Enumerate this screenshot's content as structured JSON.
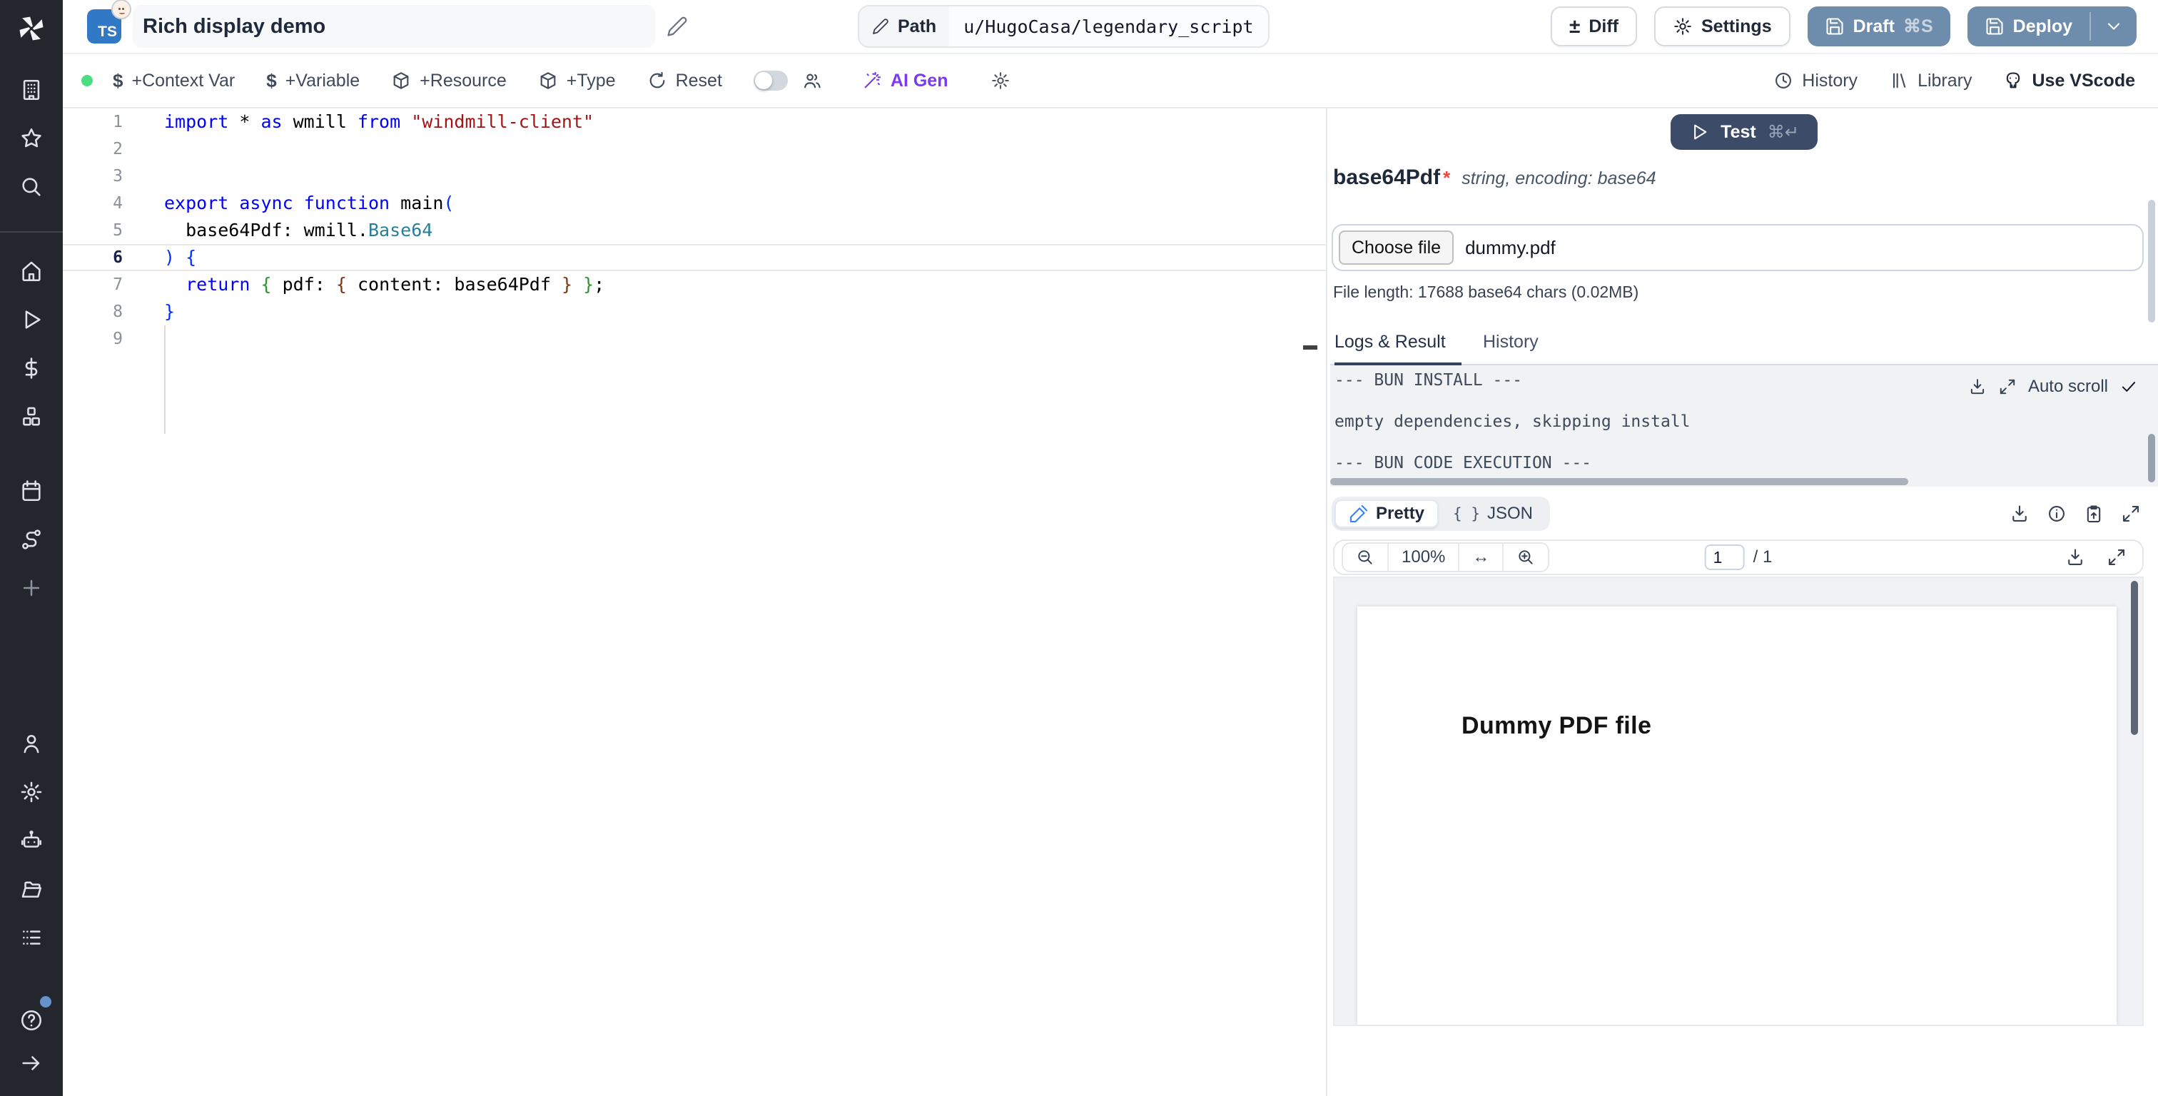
{
  "titlebar": {
    "language_badge": "TS",
    "title": "Rich display demo",
    "path_label": "Path",
    "path_value": "u/HugoCasa/legendary_script",
    "diff_label": "Diff",
    "diff_symbol": "±",
    "settings_label": "Settings",
    "draft_label": "Draft",
    "draft_kbd": "⌘S",
    "deploy_label": "Deploy"
  },
  "toolbar": {
    "context_var": "+Context Var",
    "variable": "+Variable",
    "resource": "+Resource",
    "type": "+Type",
    "reset": "Reset",
    "ai_gen": "AI Gen",
    "history": "History",
    "library": "Library",
    "use_vscode": "Use VScode",
    "dollar": "$"
  },
  "sidebar": {
    "top": [
      "building",
      "star",
      "search"
    ],
    "workspace": [
      "home",
      "play",
      "dollar",
      "cubes"
    ],
    "automation": [
      "calendar",
      "route",
      "plus"
    ],
    "admin": [
      "person",
      "gear",
      "robot",
      "folder",
      "list"
    ],
    "bottom_help": "help",
    "bottom_collapse": "arrow-right"
  },
  "editor": {
    "lines": [
      {
        "n": "1",
        "tokens": [
          {
            "t": "import",
            "c": "kw"
          },
          {
            "t": " * ",
            "c": "tx"
          },
          {
            "t": "as",
            "c": "kw"
          },
          {
            "t": " wmill ",
            "c": "tx"
          },
          {
            "t": "from",
            "c": "kw"
          },
          {
            "t": " ",
            "c": "tx"
          },
          {
            "t": "\"windmill-client\"",
            "c": "str"
          }
        ]
      },
      {
        "n": "2",
        "tokens": []
      },
      {
        "n": "3",
        "tokens": []
      },
      {
        "n": "4",
        "tokens": [
          {
            "t": "export",
            "c": "kw"
          },
          {
            "t": " ",
            "c": "tx"
          },
          {
            "t": "async",
            "c": "kw"
          },
          {
            "t": " ",
            "c": "tx"
          },
          {
            "t": "function",
            "c": "kw"
          },
          {
            "t": " main",
            "c": "tx"
          },
          {
            "t": "(",
            "c": "b1"
          }
        ]
      },
      {
        "n": "5",
        "tokens": [
          {
            "t": "  base64Pdf: wmill.",
            "c": "tx"
          },
          {
            "t": "Base64",
            "c": "type"
          }
        ]
      },
      {
        "n": "6",
        "active": true,
        "tokens": [
          {
            "t": ")",
            "c": "b1"
          },
          {
            "t": " ",
            "c": "tx"
          },
          {
            "t": "{",
            "c": "b1"
          }
        ]
      },
      {
        "n": "7",
        "tokens": [
          {
            "t": "  ",
            "c": "tx"
          },
          {
            "t": "return",
            "c": "kw"
          },
          {
            "t": " ",
            "c": "tx"
          },
          {
            "t": "{",
            "c": "b2"
          },
          {
            "t": " pdf: ",
            "c": "tx"
          },
          {
            "t": "{",
            "c": "b3"
          },
          {
            "t": " content: base64Pdf ",
            "c": "tx"
          },
          {
            "t": "}",
            "c": "b3"
          },
          {
            "t": " ",
            "c": "tx"
          },
          {
            "t": "}",
            "c": "b2"
          },
          {
            "t": ";",
            "c": "tx"
          }
        ]
      },
      {
        "n": "8",
        "tokens": [
          {
            "t": "}",
            "c": "b1"
          }
        ]
      },
      {
        "n": "9",
        "tokens": []
      }
    ]
  },
  "right_panel": {
    "test_label": "Test",
    "test_kbd": "⌘↵",
    "argument": {
      "name": "base64Pdf",
      "required_mark": "*",
      "type_info": "string, encoding: base64",
      "choose_file_label": "Choose file",
      "file_name": "dummy.pdf",
      "file_length": "File length: 17688 base64 chars (0.02MB)"
    },
    "tabs": {
      "logs": "Logs & Result",
      "history": "History"
    },
    "logs": {
      "line1": "--- BUN INSTALL ---",
      "line2": "empty dependencies, skipping install",
      "line3": "--- BUN CODE EXECUTION ---",
      "auto_scroll": "Auto scroll"
    },
    "result": {
      "pretty_label": "Pretty",
      "json_label": "JSON",
      "json_glyph": "{ }"
    },
    "pdf_viewer": {
      "zoom_level": "100%",
      "fit_width_glyph": "↔",
      "current_page": "1",
      "page_total": "/ 1",
      "page_text": "Dummy PDF file"
    }
  },
  "colors": {
    "accent_button": "#6e8cab",
    "test_button": "#3b4b68",
    "ai_gen": "#7c3aed",
    "ts_badge": "#3178c6",
    "status_dot": "#4ade80",
    "required": "#ef4444"
  }
}
